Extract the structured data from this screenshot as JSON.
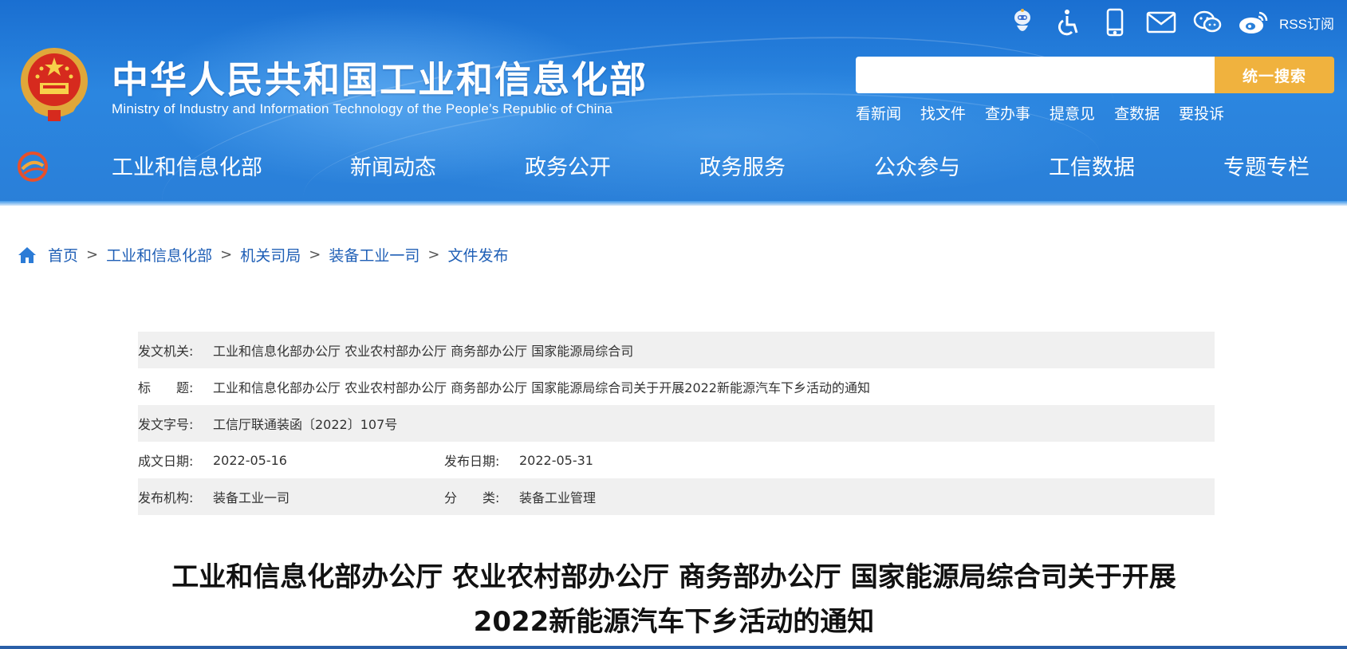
{
  "header": {
    "title": "中华人民共和国工业和信息化部",
    "subtitle": "Ministry of Industry and Information Technology of the People’s Republic of China",
    "top_icons": [
      "robot-icon",
      "accessibility-icon",
      "mobile-icon",
      "mail-icon",
      "wechat-icon",
      "weibo-icon"
    ],
    "rss_label": "RSS订阅",
    "search": {
      "placeholder": "",
      "button_label": "统一搜索"
    },
    "quick_links": [
      "看新闻",
      "找文件",
      "查办事",
      "提意见",
      "查数据",
      "要投诉"
    ],
    "nav": [
      "工业和信息化部",
      "新闻动态",
      "政务公开",
      "政务服务",
      "公众参与",
      "工信数据",
      "专题专栏"
    ]
  },
  "breadcrumb": [
    "首页",
    "工业和信息化部",
    "机关司局",
    "装备工业一司",
    "文件发布"
  ],
  "breadcrumb_separator": ">",
  "info": {
    "issuer_label": "发文机关:",
    "issuer": "工业和信息化部办公厅 农业农村部办公厅 商务部办公厅 国家能源局综合司",
    "title_label": "标　　题:",
    "title": "工业和信息化部办公厅 农业农村部办公厅 商务部办公厅 国家能源局综合司关于开展2022新能源汽车下乡活动的通知",
    "doc_no_label": "发文字号:",
    "doc_no": "工信厅联通装函〔2022〕107号",
    "created_label": "成文日期:",
    "created": "2022-05-16",
    "published_label": "发布日期:",
    "published": "2022-05-31",
    "org_label": "发布机构:",
    "org": "装备工业一司",
    "category_label": "分　　类:",
    "category": "装备工业管理"
  },
  "document": {
    "title_line1": "工业和信息化部办公厅 农业农村部办公厅 商务部办公厅 国家能源局综合司关于开展",
    "title_line2": "2022新能源汽车下乡活动的通知"
  },
  "colors": {
    "header_blue": "#2a7fd8",
    "search_button": "#f0b23e",
    "link_blue": "#1f5fb6",
    "row_shade": "#f0f0f0"
  }
}
